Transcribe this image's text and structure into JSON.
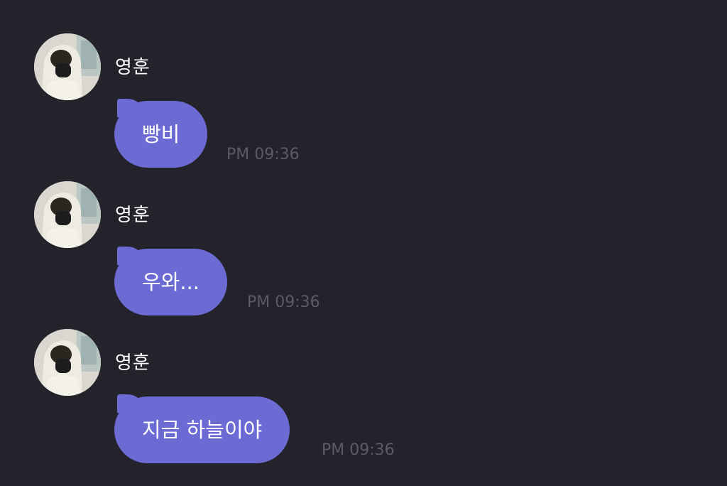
{
  "messages": [
    {
      "sender": "영훈",
      "avatar_icon": "profile-photo",
      "text": "빵비",
      "time": "PM 09:36"
    },
    {
      "sender": "영훈",
      "avatar_icon": "profile-photo",
      "text": "우와...",
      "time": "PM 09:36"
    },
    {
      "sender": "영훈",
      "avatar_icon": "profile-photo",
      "text": "지금 하늘이야",
      "time": "PM 09:36"
    }
  ],
  "colors": {
    "background": "#24232b",
    "bubble": "#6c6bd4",
    "sender_text": "#ffffff",
    "timestamp": "#5c5b63"
  }
}
